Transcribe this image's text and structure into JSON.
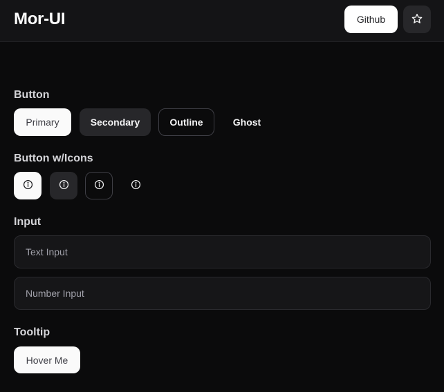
{
  "header": {
    "brand": "Mor-UI",
    "github_label": "Github",
    "star_icon": "star-icon"
  },
  "sections": {
    "button": {
      "title": "Button",
      "primary_label": "Primary",
      "secondary_label": "Secondary",
      "outline_label": "Outline",
      "ghost_label": "Ghost"
    },
    "button_icons": {
      "title": "Button w/Icons",
      "icon": "info-icon"
    },
    "input": {
      "title": "Input",
      "text_placeholder": "Text Input",
      "number_placeholder": "Number Input"
    },
    "tooltip": {
      "title": "Tooltip",
      "hover_label": "Hover Me"
    }
  },
  "colors": {
    "background": "#0b0b0c",
    "header": "#141416",
    "primary": "#fafafa",
    "secondary": "#27272a"
  }
}
